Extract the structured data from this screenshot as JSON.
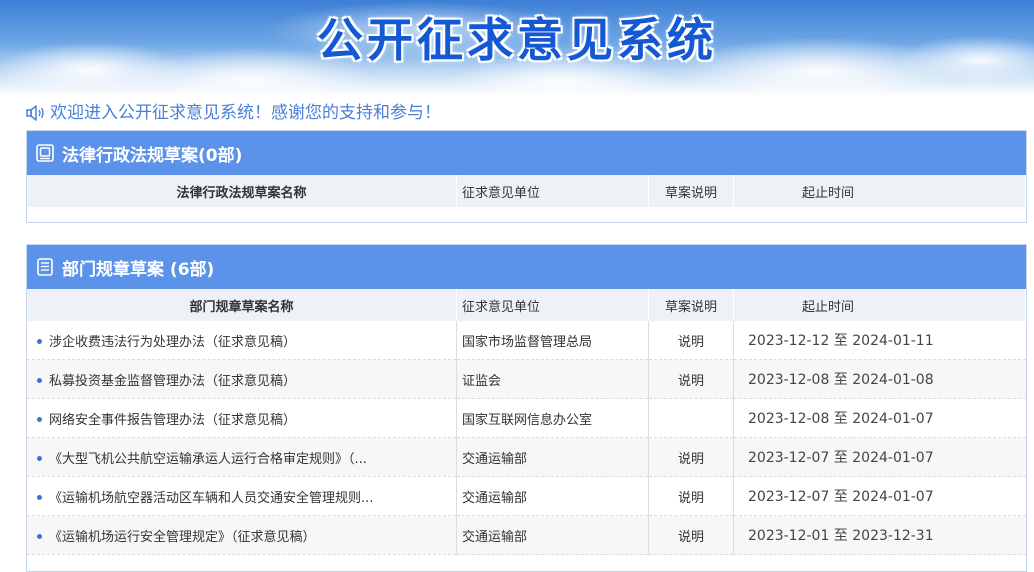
{
  "banner": {
    "title": "公开征求意见系统"
  },
  "welcome": {
    "text": "欢迎进入公开征求意见系统！感谢您的支持和参与！"
  },
  "colors": {
    "accent": "#5b93ea",
    "banner_title": "#1458d4",
    "welcome_text": "#4a7fd8",
    "bullet": "#3f72d1"
  },
  "law_section": {
    "title": "法律行政法规草案(0部)",
    "icon": "document-frame-icon",
    "columns": [
      "法律行政法规草案名称",
      "征求意见单位",
      "草案说明",
      "起止时间"
    ],
    "rows": []
  },
  "dept_section": {
    "title": "部门规章草案 (6部)",
    "icon": "document-list-icon",
    "columns": [
      "部门规章草案名称",
      "征求意见单位",
      "草案说明",
      "起止时间"
    ],
    "rows": [
      {
        "name": "涉企收费违法行为处理办法（征求意见稿）",
        "unit": "国家市场监督管理总局",
        "note": "说明",
        "period": "2023-12-12 至 2024-01-11"
      },
      {
        "name": "私募投资基金监督管理办法（征求意见稿）",
        "unit": "证监会",
        "note": "说明",
        "period": "2023-12-08 至 2024-01-08"
      },
      {
        "name": "网络安全事件报告管理办法（征求意见稿）",
        "unit": "国家互联网信息办公室",
        "note": "",
        "period": "2023-12-08 至 2024-01-07"
      },
      {
        "name": "《大型飞机公共航空运输承运人运行合格审定规则》（...",
        "unit": "交通运输部",
        "note": "说明",
        "period": "2023-12-07 至 2024-01-07"
      },
      {
        "name": "《运输机场航空器活动区车辆和人员交通安全管理规则...",
        "unit": "交通运输部",
        "note": "说明",
        "period": "2023-12-07 至 2024-01-07"
      },
      {
        "name": "《运输机场运行安全管理规定》（征求意见稿）",
        "unit": "交通运输部",
        "note": "说明",
        "period": "2023-12-01 至 2023-12-31"
      }
    ]
  }
}
